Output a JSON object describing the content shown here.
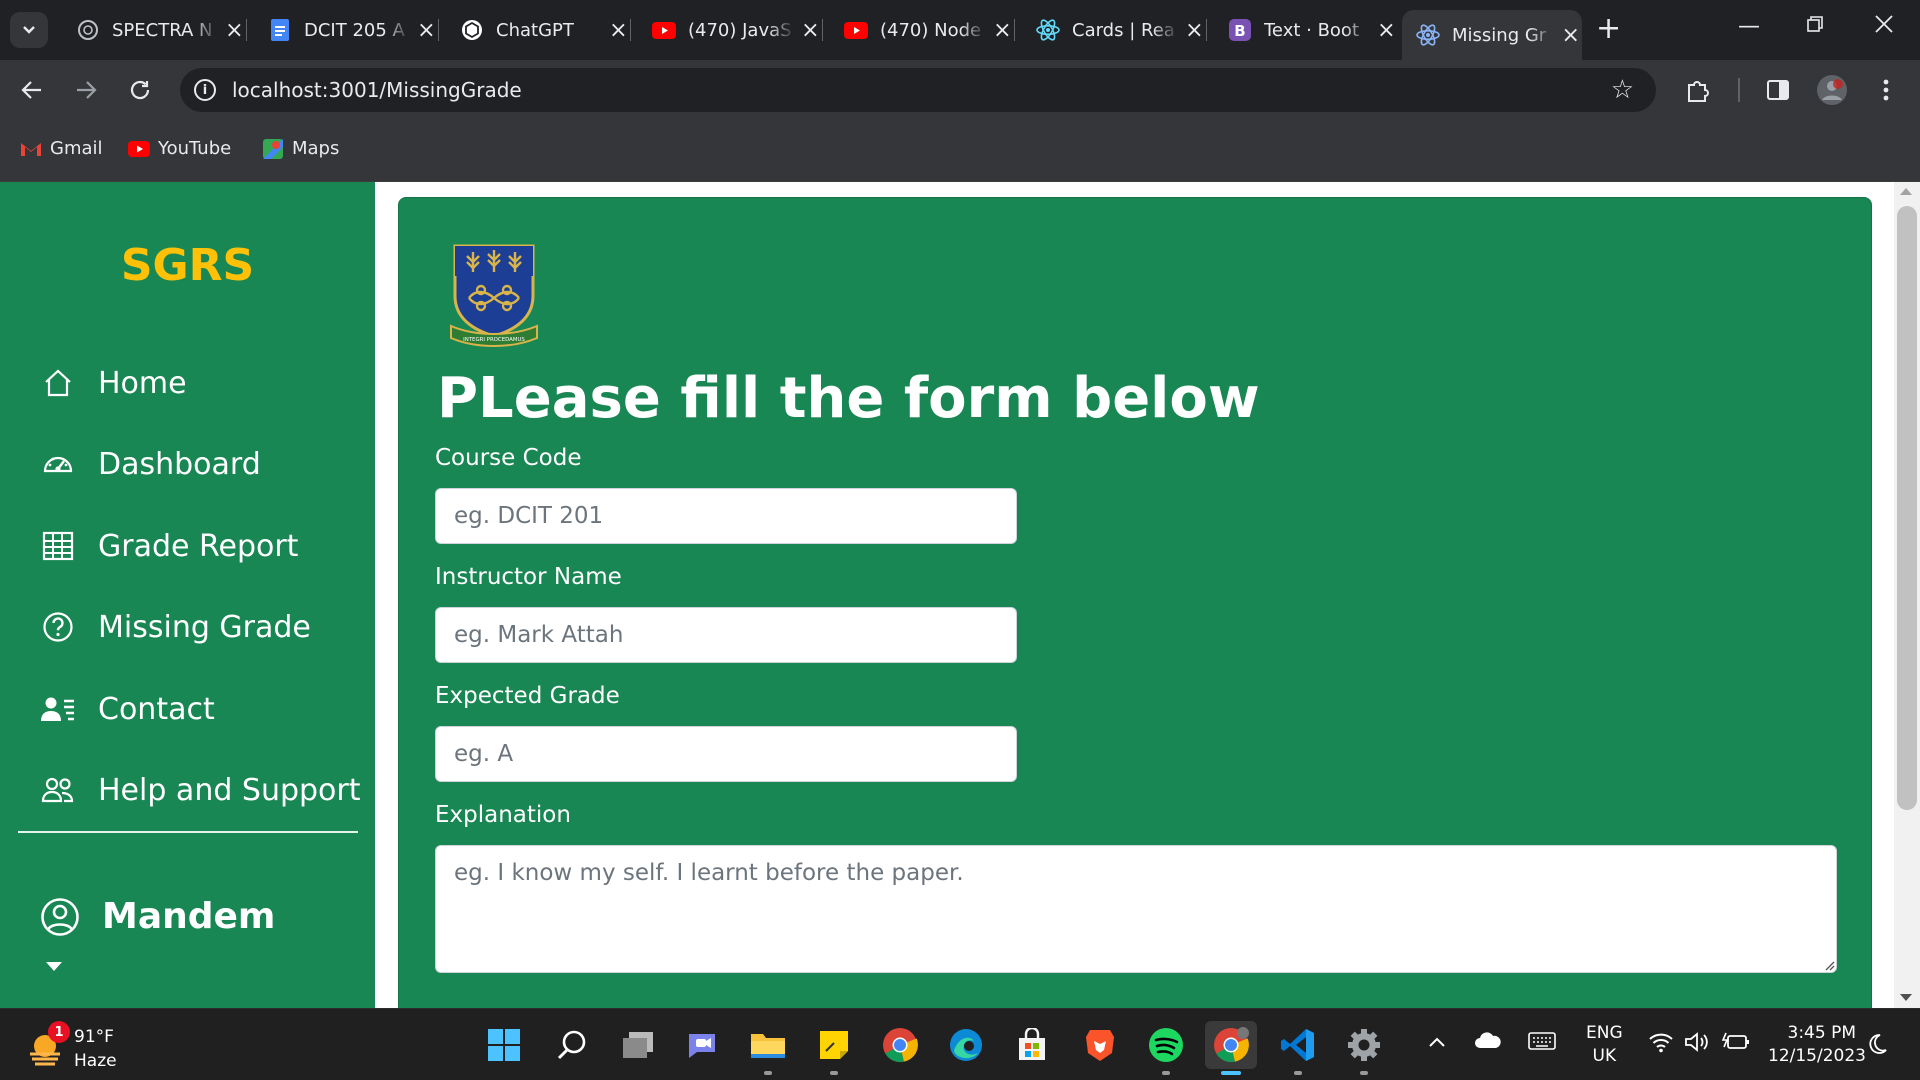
{
  "browser": {
    "tabs": [
      {
        "title": "SPECTRA N",
        "icon": "web-globe-icon",
        "active": false
      },
      {
        "title": "DCIT 205 A",
        "icon": "google-docs-icon",
        "active": false
      },
      {
        "title": "ChatGPT",
        "icon": "chatgpt-icon",
        "active": false
      },
      {
        "title": "(470) JavaS",
        "icon": "youtube-icon",
        "active": false
      },
      {
        "title": "(470) Node",
        "icon": "youtube-icon",
        "active": false
      },
      {
        "title": "Cards | Rea",
        "icon": "react-icon",
        "active": false
      },
      {
        "title": "Text · Boot",
        "icon": "bootstrap-icon",
        "active": false
      },
      {
        "title": "Missing Gr",
        "icon": "react-icon",
        "active": true
      }
    ],
    "url": "localhost:3001/MissingGrade",
    "bookmarks": [
      {
        "label": "Gmail",
        "icon": "gmail-icon"
      },
      {
        "label": "YouTube",
        "icon": "youtube-icon"
      },
      {
        "label": "Maps",
        "icon": "maps-icon"
      }
    ]
  },
  "sidebar": {
    "brand": "SGRS",
    "items": [
      {
        "label": "Home",
        "icon": "home-icon"
      },
      {
        "label": "Dashboard",
        "icon": "speedometer-icon"
      },
      {
        "label": "Grade Report",
        "icon": "table-icon"
      },
      {
        "label": "Missing Grade",
        "icon": "question-circle-icon"
      },
      {
        "label": "Contact",
        "icon": "person-lines-icon"
      },
      {
        "label": "Help and Support",
        "icon": "people-icon"
      }
    ],
    "user": {
      "name": "Mandem",
      "icon": "person-circle-icon"
    }
  },
  "form": {
    "heading": "PLease fill the form below",
    "fields": [
      {
        "label": "Course Code",
        "placeholder": "eg. DCIT 201",
        "value": ""
      },
      {
        "label": "Instructor Name",
        "placeholder": "eg. Mark Attah",
        "value": ""
      },
      {
        "label": "Expected Grade",
        "placeholder": "eg. A",
        "value": ""
      },
      {
        "label": "Explanation",
        "placeholder": "eg. I know my self. I learnt before the paper.",
        "value": ""
      }
    ],
    "crest_motto": "INTEGRI PROCEDAMUS"
  },
  "taskbar": {
    "weather": {
      "temp": "91°F",
      "condition": "Haze",
      "notification_count": "1"
    },
    "language": {
      "code": "ENG",
      "region": "UK"
    },
    "clock": {
      "time": "3:45 PM",
      "date": "12/15/2023"
    }
  },
  "colors": {
    "sidebar_bg": "#198754",
    "brand": "#ffc107",
    "submit": "#0d6efd",
    "browser_dark": "#202124",
    "browser_toolbar": "#35363a"
  }
}
